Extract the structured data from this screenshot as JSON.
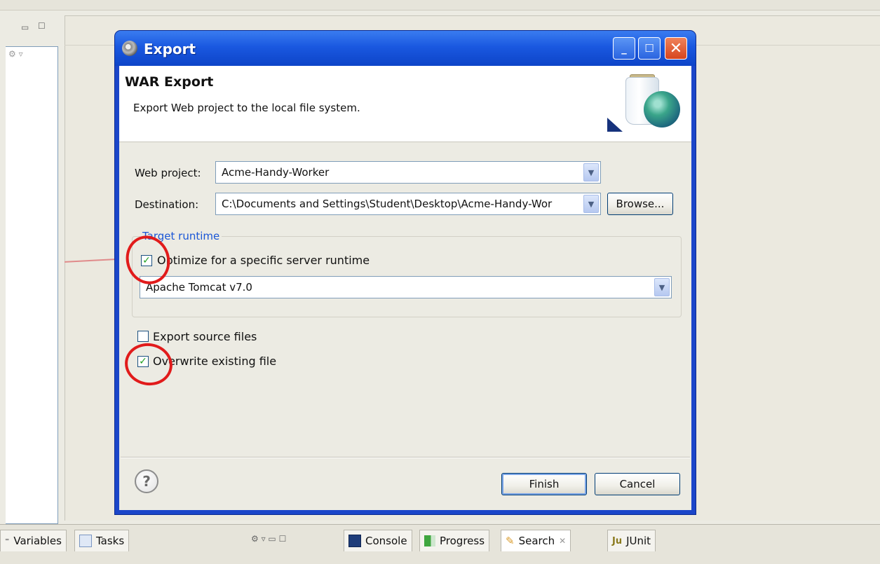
{
  "dialog": {
    "title": "Export",
    "banner_title": "WAR Export",
    "banner_description": "Export Web project to the local file system.",
    "web_project_label": "Web project:",
    "web_project_value": "Acme-Handy-Worker",
    "destination_label": "Destination:",
    "destination_value": "C:\\Documents and Settings\\Student\\Desktop\\Acme-Handy-Wor",
    "browse_label": "Browse...",
    "target_runtime_group": "Target runtime",
    "optimize_label": "Optimize for a specific server runtime",
    "optimize_checked": true,
    "runtime_value": "Apache Tomcat v7.0",
    "export_source_label": "Export source files",
    "export_source_checked": false,
    "overwrite_label": "Overwrite existing file",
    "overwrite_checked": true,
    "finish_label": "Finish",
    "cancel_label": "Cancel",
    "help_glyph": "?"
  },
  "bottom_tabs": {
    "variables": "Variables",
    "tasks": "Tasks",
    "console": "Console",
    "progress": "Progress",
    "search": "Search",
    "junit": "JUnit"
  },
  "icons": {
    "check": "✓",
    "dropdown": "▼"
  },
  "colors": {
    "annotation": "#e11b1b",
    "titlebar": "#1a58e0"
  }
}
